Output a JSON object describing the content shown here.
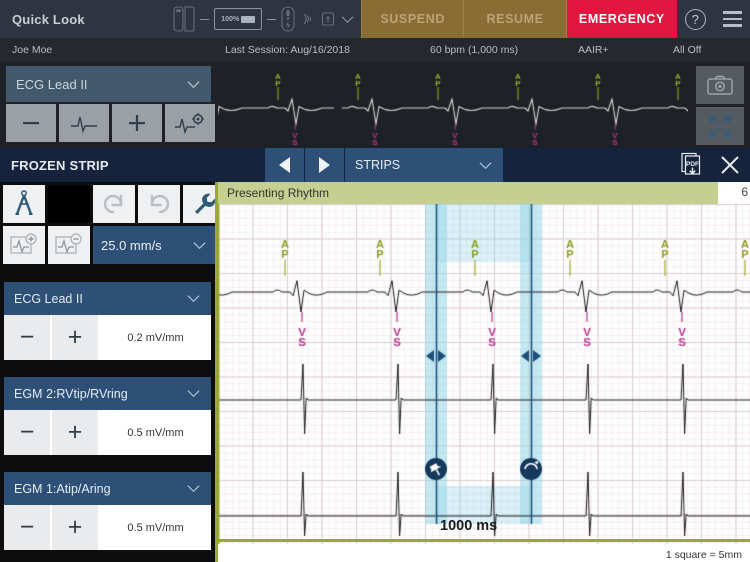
{
  "topbar": {
    "quick_look": "Quick Look",
    "battery_pct": "100%",
    "suspend_label": "SUSPEND",
    "resume_label": "RESUME",
    "emergency_label": "EMERGENCY",
    "help_label": "?",
    "icons": [
      "device-icon",
      "battery-icon",
      "wand-icon",
      "telemetry-icon",
      "magnet-icon",
      "chevron-down-icon",
      "hamburger-menu-icon"
    ]
  },
  "status": {
    "patient_name": "Joe Moe",
    "last_session": "Last Session: Aug/16/2018",
    "rate": "60 bpm (1,000 ms)",
    "mode": "AAIR+",
    "therapy": "All Off"
  },
  "live": {
    "lead_label": "ECG Lead II",
    "buttons": [
      "minus-button",
      "waveform-button",
      "plus-button",
      "waveform-settings-button"
    ],
    "right_buttons": [
      "camera-icon",
      "expand-icon"
    ]
  },
  "frozen": {
    "title": "FROZEN STRIP",
    "prev_label": "previous-strip",
    "next_label": "next-strip",
    "strips_label": "STRIPS",
    "pdf_label": "PDF",
    "close_label": "✕"
  },
  "tools": {
    "caliper": "caliper-icon",
    "undo": "undo-icon",
    "redo": "redo-icon",
    "wrench": "wrench-icon",
    "zoom_in": "zoom-in-waveform-icon",
    "zoom_out": "zoom-out-waveform-icon",
    "speed_value": "25.0 mm/s"
  },
  "channels": [
    {
      "name": "ECG Lead II",
      "gain": "0.2 mV/mm",
      "minus": "−",
      "plus": "+"
    },
    {
      "name": "EGM 2:RVtip/RVring",
      "gain": "0.5 mV/mm",
      "minus": "−",
      "plus": "+"
    },
    {
      "name": "EGM 1:Atip/Aring",
      "gain": "0.5 mV/mm",
      "minus": "−",
      "plus": "+"
    }
  ],
  "strip": {
    "rhythm_title": "Presenting Rhythm",
    "rhythm_number": "6",
    "caliper_measurement": "1000 ms",
    "scale_legend": "1 square = 5mm",
    "marker_atrial": "AP",
    "marker_ventricular": "VS"
  },
  "colors": {
    "emergency": "#e2173f",
    "suspend_bg": "#8a6d34",
    "panel_blue": "#2e5077",
    "banner_olive": "#c5cf90",
    "caliper_cyan": "#aadfec",
    "marker_green": "#9aab2e",
    "marker_magenta": "#b8348f"
  }
}
